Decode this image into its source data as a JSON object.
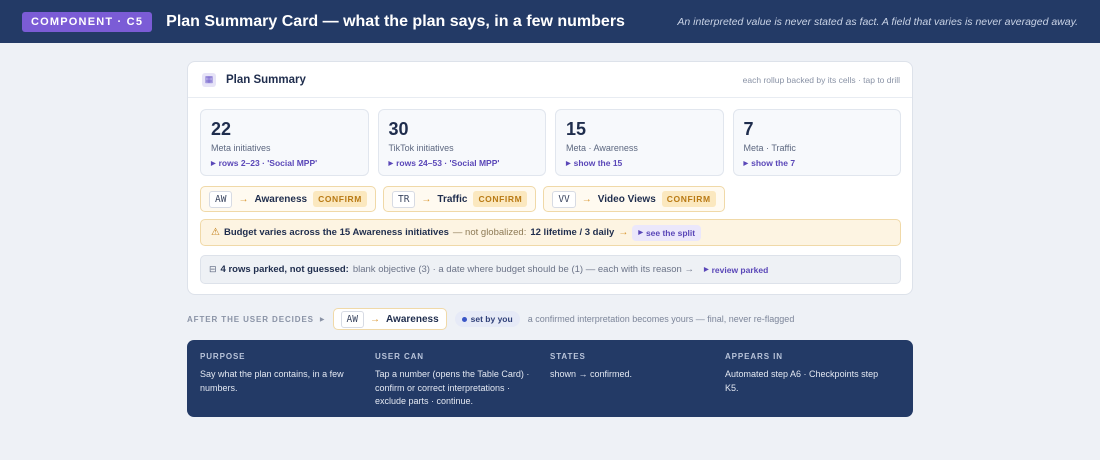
{
  "header": {
    "component_label": "COMPONENT · C5",
    "title": "Plan Summary Card — what the plan says, in a few numbers",
    "note": "An interpreted value is never stated as fact. A field that varies is never averaged away.",
    "background_color": "#233a66",
    "pill_color": "#7b5cd6"
  },
  "card": {
    "icon": "grid-icon",
    "title": "Plan Summary",
    "hint": "each rollup backed by its cells · tap to drill",
    "stats": [
      {
        "number": "22",
        "label": "Meta initiatives",
        "link": "rows 2–23 · 'Social MPP'"
      },
      {
        "number": "30",
        "label": "TikTok initiatives",
        "link": "rows 24–53 · 'Social MPP'"
      },
      {
        "number": "15",
        "label": "Meta · Awareness",
        "link": "show the 15"
      },
      {
        "number": "7",
        "label": "Meta · Traffic",
        "link": "show the 7"
      }
    ],
    "interpretations": [
      {
        "code": "AW",
        "arrow": "→",
        "target": "Awareness",
        "action": "CONFIRM"
      },
      {
        "code": "TR",
        "arrow": "→",
        "target": "Traffic",
        "action": "CONFIRM"
      },
      {
        "code": "VV",
        "arrow": "→",
        "target": "Video Views",
        "action": "CONFIRM"
      }
    ],
    "warning": {
      "icon": "⚠",
      "bold": "Budget varies across the 15 Awareness initiatives",
      "muted": "— not globalized:",
      "detail": "12 lifetime / 3 daily",
      "arrow": "→",
      "link": "see the split"
    },
    "parked": {
      "icon": "⊟",
      "bold": "4 rows parked, not guessed:",
      "detail": "blank objective (3) · a date where budget should be (1) — each with its reason →",
      "link": "review parked"
    }
  },
  "after": {
    "label": "AFTER THE USER DECIDES",
    "code": "AW",
    "arrow": "→",
    "target": "Awareness",
    "badge": "set by you",
    "note": "a confirmed interpretation becomes yours — final, never re-flagged"
  },
  "info": [
    {
      "heading": "PURPOSE",
      "body": "Say what the plan contains, in a few numbers."
    },
    {
      "heading": "USER CAN",
      "body": "Tap a number (opens the Table Card) · confirm or correct interpretations · exclude parts · continue."
    },
    {
      "heading": "STATES",
      "body": "shown → confirmed."
    },
    {
      "heading": "APPEARS IN",
      "body": "Automated step A6 · Checkpoints step K5."
    }
  ]
}
